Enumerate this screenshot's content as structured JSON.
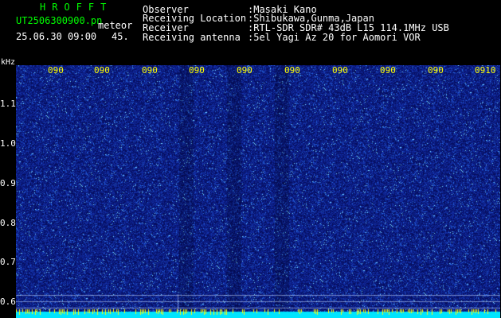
{
  "header": {
    "app_title": "HROFFT",
    "file_name": "UT2506300900.pn",
    "meteor_label": "meteor",
    "datetime": "25.06.30 09:00",
    "count": "45.",
    "info": [
      {
        "label": "Observer",
        "value": ":Masaki Kano"
      },
      {
        "label": "Receiving Location",
        "value": ":Shibukawa,Gunma,Japan"
      },
      {
        "label": "Receiver",
        "value": ":RTL-SDR SDR# 43dB L15 114.1MHz USB"
      },
      {
        "label": "Receiving antenna",
        "value": ":5el Yagi Az 20 for Aomori VOR"
      }
    ]
  },
  "axis": {
    "y_unit": "kHz",
    "y_ticks": [
      "1.1",
      "1.0",
      "0.9",
      "0.8",
      "0.7",
      "0.6"
    ],
    "x_ticks": [
      "090",
      "090",
      "090",
      "090",
      "090",
      "090",
      "090",
      "090",
      "090",
      "0910"
    ]
  },
  "colors": {
    "background": "#000000",
    "spectrogram_base": "#0a1a78",
    "bottom_band": "#00e5ff",
    "header_green": "#00ff00",
    "tick_yellow": "#ffff00"
  }
}
